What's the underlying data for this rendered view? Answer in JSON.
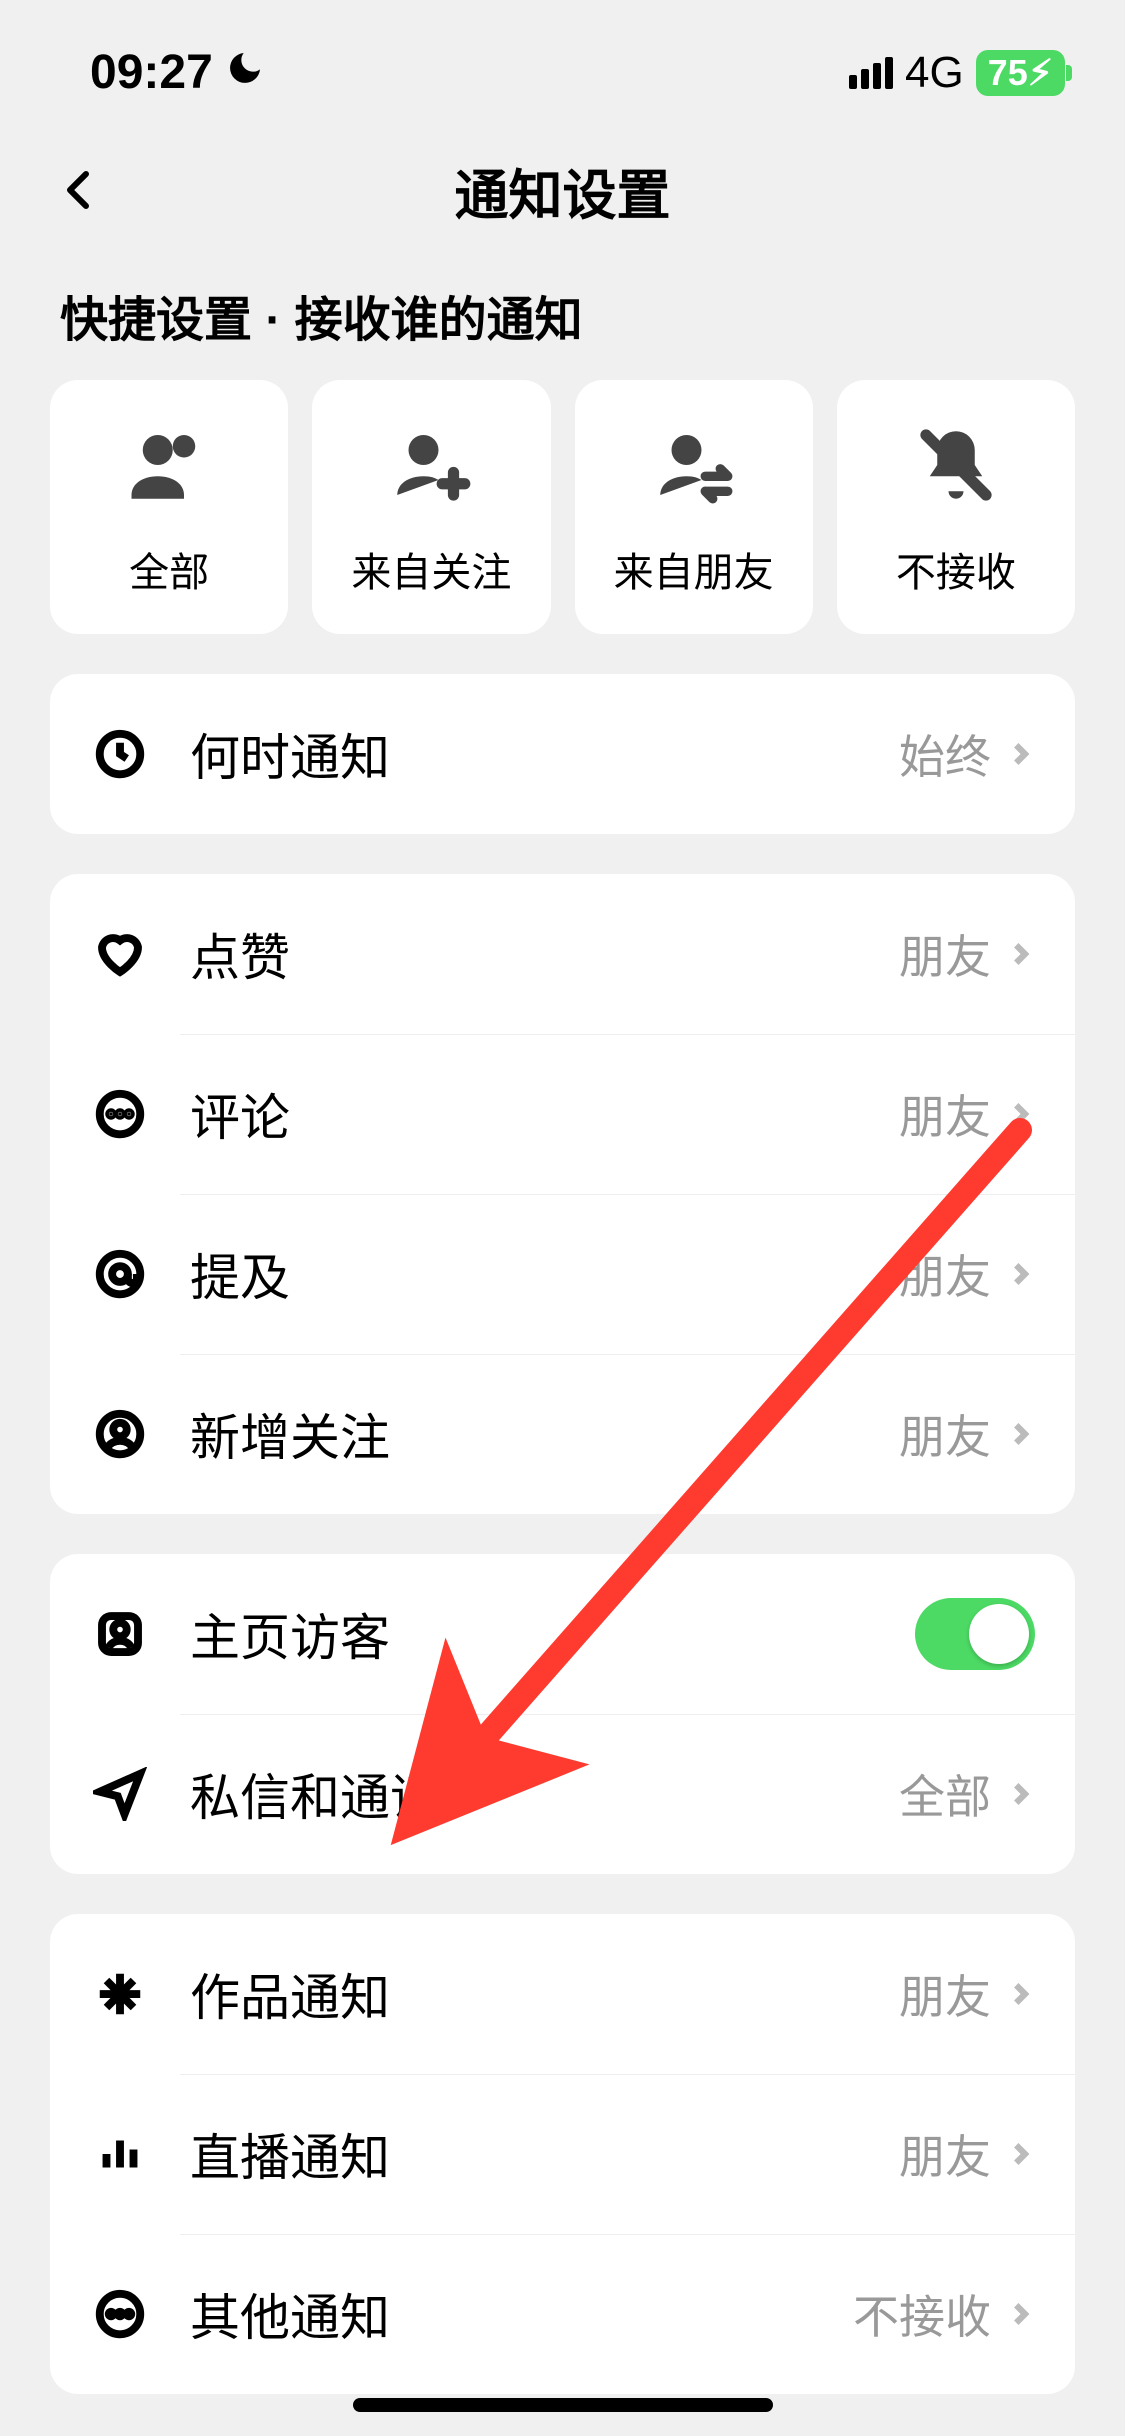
{
  "status": {
    "time": "09:27",
    "network": "4G",
    "battery": "75"
  },
  "header": {
    "title": "通知设置"
  },
  "subtitle": "快捷设置 · 接收谁的通知",
  "quick": [
    {
      "label": "全部"
    },
    {
      "label": "来自关注"
    },
    {
      "label": "来自朋友"
    },
    {
      "label": "不接收"
    }
  ],
  "rows": {
    "when_notify": {
      "label": "何时通知",
      "value": "始终"
    },
    "like": {
      "label": "点赞",
      "value": "朋友"
    },
    "comment": {
      "label": "评论",
      "value": "朋友"
    },
    "mention": {
      "label": "提及",
      "value": "朋友"
    },
    "new_follow": {
      "label": "新增关注",
      "value": "朋友"
    },
    "visitor": {
      "label": "主页访客"
    },
    "dm_call": {
      "label": "私信和通话",
      "value": "全部"
    },
    "work_notify": {
      "label": "作品通知",
      "value": "朋友"
    },
    "live_notify": {
      "label": "直播通知",
      "value": "朋友"
    },
    "other_notify": {
      "label": "其他通知",
      "value": "不接收"
    }
  },
  "toggles": {
    "visitor": true
  },
  "annotation": {
    "arrow_color": "#ff3b30"
  }
}
